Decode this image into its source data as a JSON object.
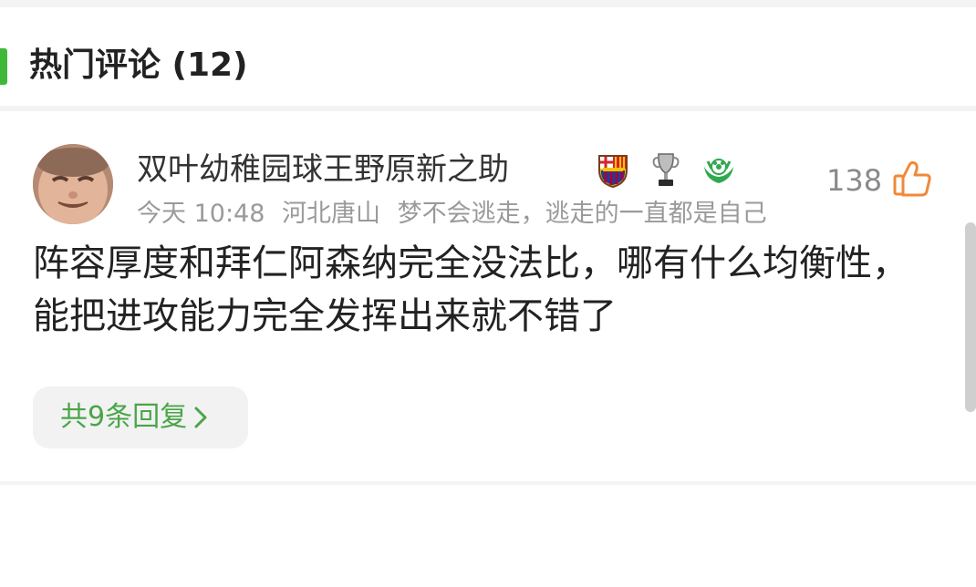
{
  "section": {
    "title": "热门评论 (12)"
  },
  "comment": {
    "username": "双叶幼稚园球王野原新之助",
    "badges": [
      {
        "icon": "fcb-crest-icon",
        "color": "#a50044"
      },
      {
        "icon": "trophy-icon",
        "color": "#9a9a9a"
      },
      {
        "icon": "green-club-icon",
        "color": "#2fa84f"
      }
    ],
    "meta": {
      "time": "今天 10:48",
      "location": "河北唐山",
      "signature": "梦不会逃走，逃走的一直都是自己"
    },
    "like_count": "138",
    "like_icon": "thumbs-up-icon",
    "text": "阵容厚度和拜仁阿森纳完全没法比，哪有什么均衡性，能把进攻能力完全发挥出来就不错了",
    "replies_label": "共9条回复"
  },
  "colors": {
    "accent": "#3fb83a",
    "reply_text": "#4aa548",
    "like_orange": "#f0893a"
  }
}
